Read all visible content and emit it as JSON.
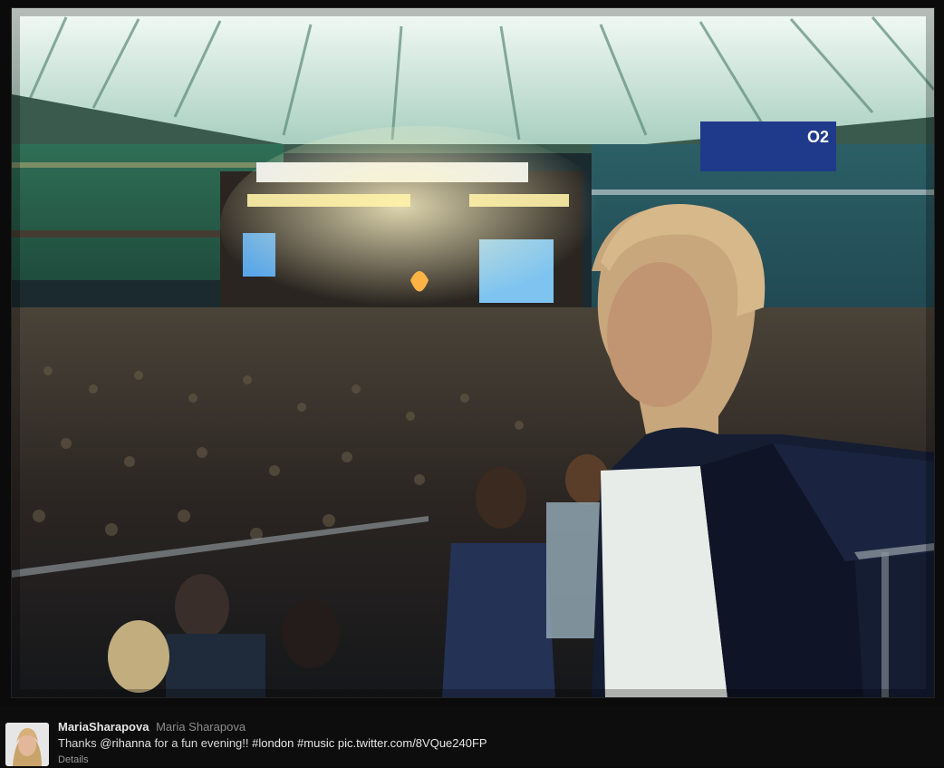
{
  "photo": {
    "alt_subject": "",
    "stadium_sign": "O2"
  },
  "tweet": {
    "screen_name": "MariaSharapova",
    "full_name": "Maria Sharapova",
    "text_before": "Thanks ",
    "mention": "@rihanna",
    "text_middle": " for a fun evening!! ",
    "hashtag1": "#london",
    "space": " ",
    "hashtag2": "#music",
    "space2": " ",
    "pic_link": "pic.twitter.com/8VQue240FP",
    "details_label": "Details"
  },
  "colors": {
    "background": "#0b0b0b",
    "text": "#d8d8d8",
    "muted": "#8c8c8c"
  }
}
